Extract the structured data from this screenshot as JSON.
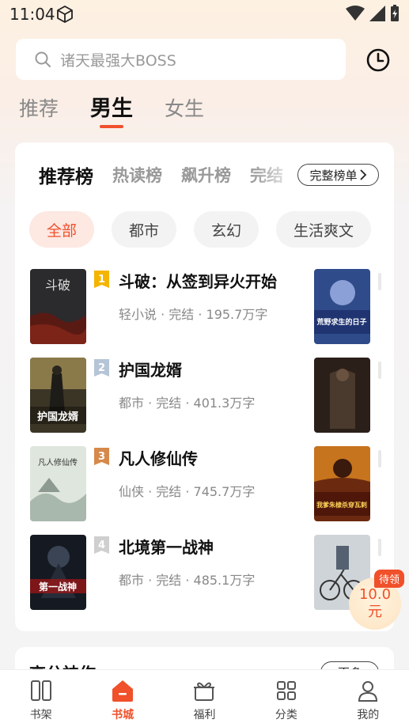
{
  "status_bar": {
    "time": "11:04"
  },
  "search": {
    "placeholder": "诸天最强大BOSS"
  },
  "top_tabs": [
    {
      "label": "推荐",
      "active": false
    },
    {
      "label": "男生",
      "active": true
    },
    {
      "label": "女生",
      "active": false
    }
  ],
  "ranking": {
    "tabs": [
      "推荐榜",
      "热读榜",
      "飙升榜",
      "完结"
    ],
    "full_list_label": "完整榜单",
    "categories": [
      "全部",
      "都市",
      "玄幻",
      "生活爽文"
    ],
    "books": [
      {
        "rank": "1",
        "title": "斗破：从签到异火开始",
        "meta": "轻小说 · 完结 · 195.7万字",
        "cover_text": "斗破"
      },
      {
        "rank": "2",
        "title": "护国龙婿",
        "meta": "都市 · 完结 · 401.3万字",
        "cover_text": "护国龙婿"
      },
      {
        "rank": "3",
        "title": "凡人修仙传",
        "meta": "仙侠 · 完结 · 745.7万字",
        "cover_text": "凡人修仙传"
      },
      {
        "rank": "4",
        "title": "北境第一战神",
        "meta": "都市 · 完结 · 485.1万字",
        "cover_text": "第一战神"
      }
    ],
    "side_covers": [
      "荒野求生的日子",
      "",
      "我爹朱棣杀穿瓦剌",
      ""
    ],
    "colors": {
      "accent": "#f0502a",
      "rank1": "#f5b400",
      "rank2": "#b5c4d6",
      "rank3": "#d6894a",
      "rank4": "#cfcfcf"
    }
  },
  "reward": {
    "tag": "待领",
    "amount": "10.0",
    "unit": "元"
  },
  "second_card": {
    "title": "高分神作",
    "more_label": "更多"
  },
  "bottom_nav": [
    {
      "label": "书架",
      "icon": "bookshelf-icon",
      "active": false
    },
    {
      "label": "书城",
      "icon": "bookstore-icon",
      "active": true
    },
    {
      "label": "福利",
      "icon": "gift-icon",
      "active": false
    },
    {
      "label": "分类",
      "icon": "category-icon",
      "active": false
    },
    {
      "label": "我的",
      "icon": "profile-icon",
      "active": false
    }
  ]
}
